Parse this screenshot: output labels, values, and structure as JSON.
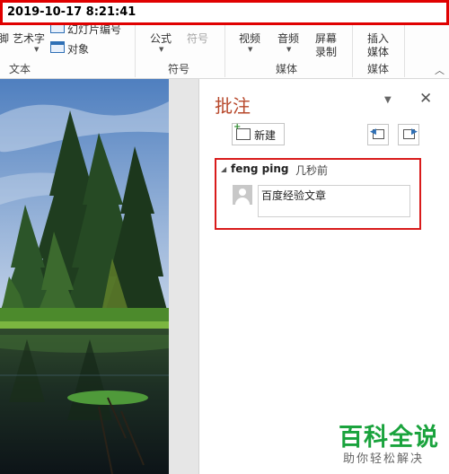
{
  "timestamp": "2019-10-17 8:21:41",
  "ribbon": {
    "text_group": {
      "wordart_label": "艺术字",
      "slide_number_label": "幻灯片编号",
      "object_label": "对象",
      "group_label": "文本"
    },
    "symbols_group": {
      "equation_label": "公式",
      "symbol_label": "符号",
      "group_label": "符号"
    },
    "media_group": {
      "video_label": "视频",
      "audio_label": "音频",
      "screen_recording_label_line1": "屏幕",
      "screen_recording_label_line2": "录制",
      "group_label": "媒体"
    },
    "insert_media_group": {
      "insert_media_label_line1": "插入",
      "insert_media_label_line2": "媒体",
      "group_label": "媒体"
    }
  },
  "comments_pane": {
    "title": "批注",
    "new_button_label": "新建",
    "thread": {
      "author": "feng ping",
      "time_ago": "几秒前",
      "reply_text": "百度经验文章"
    }
  },
  "watermark": {
    "title": "百科全说",
    "subtitle": "助你轻松解决"
  },
  "colors": {
    "accent": "#b7472a",
    "highlight_red": "#e00000",
    "watermark_green": "#1aa33d"
  }
}
